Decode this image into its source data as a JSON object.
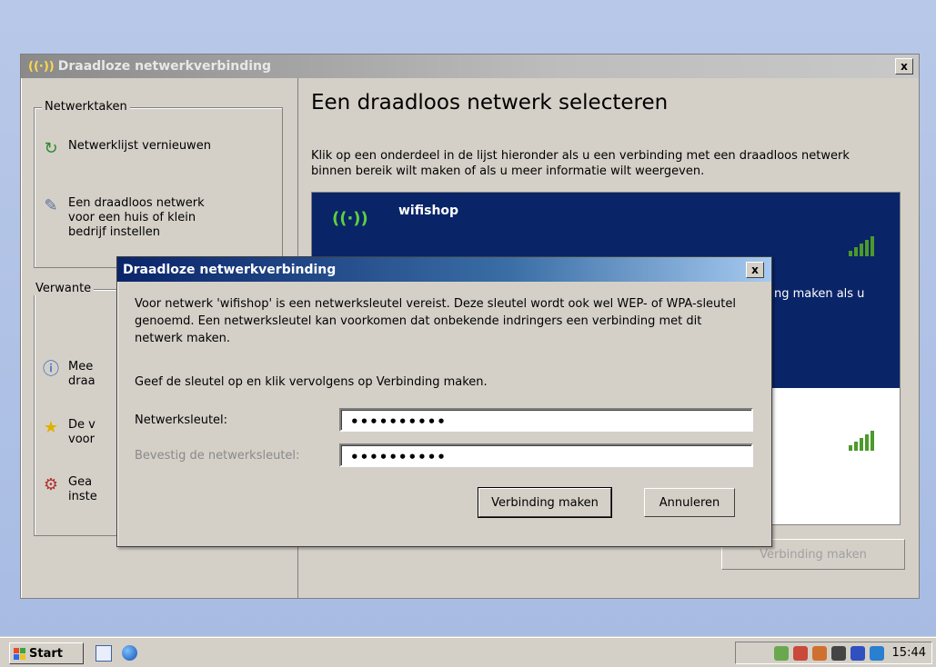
{
  "main_window": {
    "title": "Draadloze netwerkverbinding",
    "close_label": "x",
    "left": {
      "tasks_group": "Netwerktaken",
      "task_refresh": "Netwerklijst vernieuwen",
      "task_setup": "Een draadloos netwerk voor een huis of klein bedrijf instellen",
      "related_group": "Verwante",
      "rel_1": "Mee",
      "rel_1b": "draa",
      "rel_2": "De v",
      "rel_2b": "voor",
      "rel_3": "Gea",
      "rel_3b": "inste"
    },
    "right": {
      "heading": "Een draadloos netwerk selecteren",
      "intro": "Klik op een onderdeel in de lijst hieronder als u een verbinding met een draadloos netwerk binnen bereik wilt maken of als u meer informatie wilt weergeven.",
      "network_name": "wifishop",
      "partial_text": "ng maken als u",
      "connect_button": "Verbinding maken"
    }
  },
  "dialog": {
    "title": "Draadloze netwerkverbinding",
    "close_label": "x",
    "message": "Voor netwerk 'wifishop' is een netwerksleutel vereist. Deze sleutel wordt ook wel WEP- of WPA-sleutel genoemd. Een netwerksleutel kan voorkomen dat onbekende indringers een verbinding met dit netwerk maken.",
    "instruction": "Geef de sleutel op en klik vervolgens op Verbinding maken.",
    "key_label": "Netwerksleutel:",
    "key_value": "••••••••••",
    "confirm_label": "Bevestig de netwerksleutel:",
    "confirm_value": "••••••••••",
    "ok_button": "Verbinding maken",
    "cancel_button": "Annuleren"
  },
  "taskbar": {
    "start_label": "Start",
    "clock": "15:44"
  },
  "colors": {
    "selection_blue": "#0a2468",
    "signal_green": "#4c9a2a"
  }
}
